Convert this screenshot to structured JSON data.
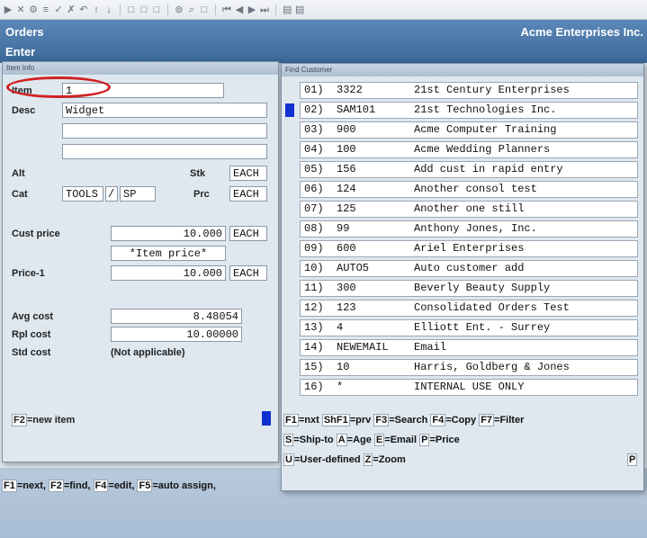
{
  "app": {
    "title": "Orders",
    "subtitle": "Enter",
    "company": "Acme Enterprises Inc."
  },
  "toolbar_icons": [
    "play-icon",
    "close-icon",
    "gear-icon",
    "list-icon",
    "check-icon",
    "x-icon",
    "undo-icon",
    "up-icon",
    "down-icon",
    "square-icon",
    "square-icon",
    "square-icon",
    "binoculars-icon",
    "search-icon",
    "square-icon",
    "first-icon",
    "prev-icon",
    "next-icon",
    "last-icon",
    "page-icon",
    "page-icon"
  ],
  "item_form": {
    "window_title": "Item Info",
    "item_label": "Item",
    "item_value": "1",
    "desc_label": "Desc",
    "desc_lines": [
      "Widget",
      "",
      ""
    ],
    "alt_label": "Alt",
    "stk_label": "Stk",
    "stk_value": "EACH",
    "cat_label": "Cat",
    "cat_value": "TOOLS",
    "cat_sep": "/",
    "cat_sub": "SP",
    "prc_label": "Prc",
    "prc_value": "EACH",
    "cust_price_label": "Cust price",
    "cust_price_value": "10.000",
    "cust_price_uom": "EACH",
    "price_note": "*Item price*",
    "price1_label": "Price-1",
    "price1_value": "10.000",
    "price1_uom": "EACH",
    "avg_cost_label": "Avg cost",
    "avg_cost_value": "8.48054",
    "rpl_cost_label": "Rpl cost",
    "rpl_cost_value": "10.00000",
    "std_cost_label": "Std cost",
    "std_cost_value": "(Not applicable)",
    "footer_key": "F2",
    "footer_text": "=new item"
  },
  "customer_list": {
    "window_title": "Find Customer",
    "rows": [
      {
        "num": "01)",
        "code": "3322",
        "name": "21st Century Enterprises"
      },
      {
        "num": "02)",
        "code": "SAM101",
        "name": "21st Technologies Inc."
      },
      {
        "num": "03)",
        "code": "900",
        "name": "Acme Computer Training"
      },
      {
        "num": "04)",
        "code": "100",
        "name": "Acme Wedding Planners"
      },
      {
        "num": "05)",
        "code": "156",
        "name": "Add cust in rapid entry"
      },
      {
        "num": "06)",
        "code": "124",
        "name": "Another consol test"
      },
      {
        "num": "07)",
        "code": "125",
        "name": "Another one still"
      },
      {
        "num": "08)",
        "code": "99",
        "name": "Anthony Jones, Inc."
      },
      {
        "num": "09)",
        "code": "600",
        "name": "Ariel Enterprises"
      },
      {
        "num": "10)",
        "code": "AUTO5",
        "name": "Auto customer add"
      },
      {
        "num": "11)",
        "code": "300",
        "name": "Beverly Beauty Supply"
      },
      {
        "num": "12)",
        "code": "123",
        "name": "Consolidated Orders Test"
      },
      {
        "num": "13)",
        "code": "4",
        "name": "Elliott Ent. - Surrey"
      },
      {
        "num": "14)",
        "code": "NEWEMAIL",
        "name": "Email"
      },
      {
        "num": "15)",
        "code": "10",
        "name": "Harris, Goldberg & Jones"
      },
      {
        "num": "16)",
        "code": "*",
        "name": "INTERNAL USE ONLY"
      }
    ],
    "selected_row": 2,
    "keys_line1": [
      {
        "k": "F1",
        "t": "=nxt "
      },
      {
        "k": "ShF1",
        "t": "=prv "
      },
      {
        "k": "F3",
        "t": "=Search "
      },
      {
        "k": "F4",
        "t": "=Copy "
      },
      {
        "k": "F7",
        "t": "=Filter"
      }
    ],
    "keys_line2": [
      {
        "k": "S",
        "t": "=Ship-to "
      },
      {
        "k": "A",
        "t": "=Age "
      },
      {
        "k": "E",
        "t": "=Email "
      },
      {
        "k": "P",
        "t": "=Price"
      }
    ],
    "keys_line3": [
      {
        "k": "U",
        "t": "=User-defined "
      },
      {
        "k": "Z",
        "t": "=Zoom"
      }
    ],
    "corner_key": "P"
  },
  "bottom_keys": [
    {
      "k": "F1",
      "t": "=next, "
    },
    {
      "k": "F2",
      "t": "=find, "
    },
    {
      "k": "F4",
      "t": "=edit, "
    },
    {
      "k": "F5",
      "t": "=auto assign, "
    }
  ],
  "colors": {
    "appbar": "#4a78a8",
    "highlight_oval": "#d02020",
    "marker": "#1030d0"
  }
}
